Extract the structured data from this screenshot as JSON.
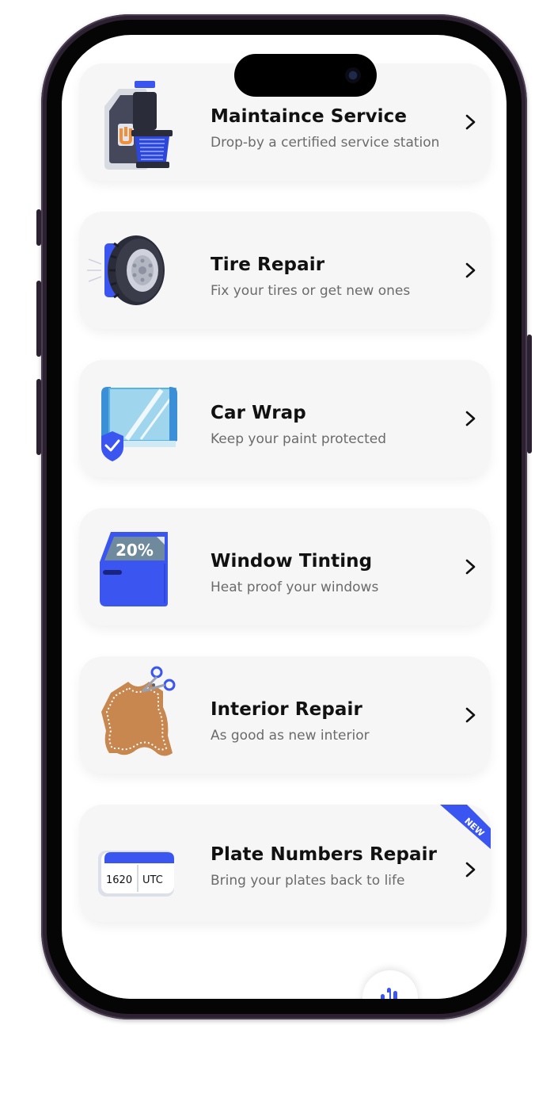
{
  "services": [
    {
      "title": "Maintaince Service",
      "subtitle": "Drop-by a certified service station",
      "icon": "oil-filter-icon"
    },
    {
      "title": "Tire Repair",
      "subtitle": "Fix your tires or get new ones",
      "icon": "tire-icon"
    },
    {
      "title": "Car Wrap",
      "subtitle": "Keep your paint protected",
      "icon": "wrap-film-icon"
    },
    {
      "title": "Window Tinting",
      "subtitle": "Heat proof your windows",
      "icon": "car-door-tint-icon",
      "tint_label": "20%"
    },
    {
      "title": "Interior Repair",
      "subtitle": "As good as new interior",
      "icon": "leather-scissors-icon"
    },
    {
      "title": "Plate Numbers Repair",
      "subtitle": "Bring your plates back to life",
      "icon": "license-plate-icon",
      "badge": "NEW",
      "plate_number": "1620",
      "plate_code": "UTC"
    }
  ],
  "colors": {
    "accent": "#3b55f0",
    "card": "#f6f6f6",
    "title": "#111111",
    "subtitle": "#6b6b6b",
    "leather": "#c7874f"
  }
}
